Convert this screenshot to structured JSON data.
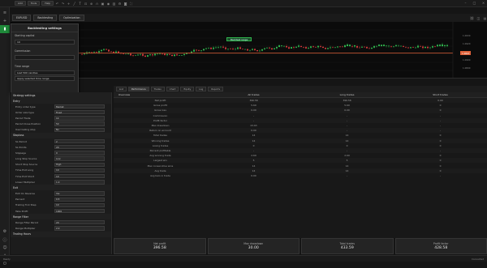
{
  "titlebar": {
    "buttons": [
      "Add",
      "Tools",
      "Help"
    ],
    "window_controls": [
      "minimize-icon",
      "maximize-icon",
      "close-icon"
    ]
  },
  "tabs": [
    "EURUSD",
    "Backtesting",
    "Optimization"
  ],
  "sidebar_icons": [
    "menu-icon",
    "add-icon",
    "chart-icon",
    "settings-icon",
    "info-icon",
    "user-icon",
    "alert-icon",
    "power-icon"
  ],
  "chart": {
    "badge_label": "Backtest range",
    "price_labels": [
      "1.0930",
      "1.0920",
      "1.0910",
      "1.0900",
      "1.0890",
      "1.0880"
    ],
    "current_price": "1.0897"
  },
  "dropdown": {
    "title": "Backtesting settings",
    "fields": [
      {
        "label": "Starting capital",
        "value": "10"
      },
      {
        "label": "Commission",
        "value": ""
      },
      {
        "label": "Time range",
        "value": "Last 500 candles"
      }
    ],
    "option": "Apply selected time range"
  },
  "stats_tabs": [
    "List",
    "Performance",
    "Trades",
    "Chart",
    "Equity",
    "Log",
    "Reports"
  ],
  "left_panel": {
    "header": "Strategy settings",
    "sections": [
      {
        "title": "Entry",
        "rows": [
          {
            "label": "Entry order type",
            "value": "Market"
          },
          {
            "label": "Order size type",
            "value": "Fixed"
          },
          {
            "label": "Period Trade",
            "value": "14"
          },
          {
            "label": "Period Close Position",
            "value": "50"
          },
          {
            "label": "Use trailing stop",
            "value": "No"
          }
        ]
      },
      {
        "title": "Stoploss",
        "rows": [
          {
            "label": "SL Period",
            "value": "2"
          },
          {
            "label": "SL Points",
            "value": "20"
          },
          {
            "label": "Slippage",
            "value": "0"
          },
          {
            "label": "Long Stop Source",
            "value": "Low"
          },
          {
            "label": "Short Stop Source",
            "value": "High"
          },
          {
            "label": "Time Exit Long",
            "value": "10"
          },
          {
            "label": "Time Exit Short",
            "value": "10"
          },
          {
            "label": "Lower Multiplier",
            "value": "1.0"
          }
        ]
      },
      {
        "title": "Exit",
        "rows": [
          {
            "label": "Exit On Reverse",
            "value": "Yes"
          },
          {
            "label": "Percent",
            "value": "0.5"
          },
          {
            "label": "Trailing Tick Step",
            "value": "10"
          },
          {
            "label": "Take Profit",
            "value": "1000"
          }
        ]
      },
      {
        "title": "Range Filter",
        "rows": [
          {
            "label": "Range Filter Period",
            "value": "20"
          },
          {
            "label": "Range Multiplier",
            "value": "2.0"
          }
        ]
      },
      {
        "title": "Trading Hours",
        "rows": []
      }
    ]
  },
  "table": {
    "headers": [
      "Overview",
      "All trades",
      "Long trades",
      "Short trades"
    ],
    "rows": [
      [
        "Net profit",
        "396.58",
        "396.58",
        "0.00"
      ],
      [
        "Gross profit",
        "5.69",
        "5.69",
        "0"
      ],
      [
        "Gross loss",
        "0.00",
        "0.00",
        "0"
      ],
      [
        "Commission",
        "-",
        "-",
        "-"
      ],
      [
        "Profit factor",
        "-",
        "-",
        "-"
      ],
      [
        "Max drawdown",
        "23.63",
        "-",
        "-"
      ],
      [
        "Return on account",
        "0.00",
        "-",
        "-"
      ],
      [
        "Total trades",
        "14",
        "14",
        "0"
      ],
      [
        "Winning trades",
        "14",
        "14",
        "0"
      ],
      [
        "Losing trades",
        "0",
        "0",
        "0"
      ],
      [
        "Percent profitable",
        "-",
        "-",
        "-"
      ],
      [
        "Avg winning trade",
        "2.69",
        "2.69",
        "0"
      ],
      [
        "Largest win",
        "5",
        "5",
        "0"
      ],
      [
        "Max consecutive wins",
        "14",
        "14",
        "0"
      ],
      [
        "Avg trade",
        "14",
        "14",
        "0"
      ],
      [
        "Avg bars in trade",
        "0.00",
        "-",
        "-"
      ]
    ]
  },
  "summary": [
    {
      "label": "Net profit",
      "value": "396.58"
    },
    {
      "label": "Max drawdown",
      "value": "30.00"
    },
    {
      "label": "Total trades",
      "value": "433.59"
    },
    {
      "label": "Profit factor",
      "value": "428.58"
    }
  ],
  "statusbar": {
    "left": "Ready",
    "right": "Connected"
  },
  "colors": {
    "accent_green": "#1f8a3a",
    "price_line": "#e0623a",
    "candle_up": "#2fb24c",
    "candle_down": "#d23c3c"
  }
}
